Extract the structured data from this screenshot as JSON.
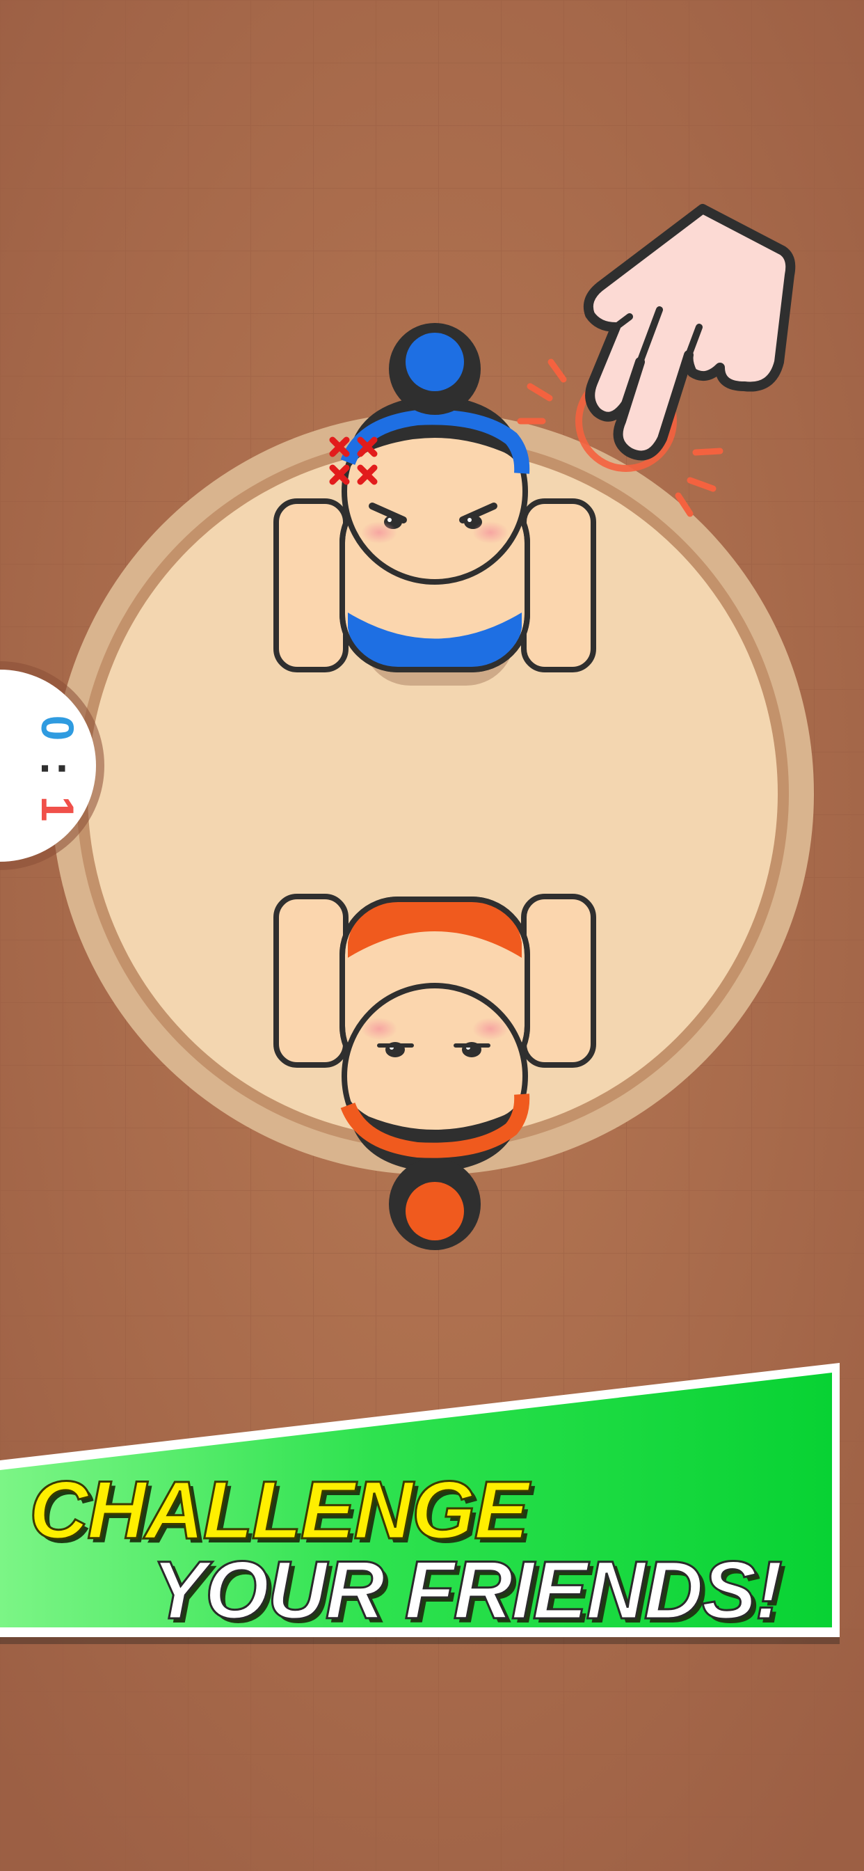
{
  "colors": {
    "floor": "#a5684a",
    "ring_outer": "#d9b48e",
    "ring_mid": "#c3926b",
    "ring_inner": "#f3d6b0",
    "skin": "#fbd6ae",
    "outline": "#2f2f2f",
    "hair": "#2f2f2f",
    "blue_team": "#1e6fe3",
    "orange_team": "#f05a1e",
    "score_blue": "#2f9be0",
    "score_red": "#f0504a",
    "banner_green": "#12d63c",
    "banner_yellow": "#ffef00",
    "banner_white": "#ffffff",
    "tap_effect": "#f4623f",
    "anger_mark": "#e21c1c"
  },
  "score": {
    "blue": "0",
    "separator": ":",
    "red": "1"
  },
  "players": {
    "top": {
      "team": "blue",
      "expression": "angry",
      "icon": "anger-vein-icon"
    },
    "bottom": {
      "team": "orange",
      "expression": "calm"
    }
  },
  "hint": {
    "icon": "pointing-hand-icon",
    "effect": "tap-ripple"
  },
  "banner": {
    "line1": "CHALLENGE",
    "line2": "YOUR FRIENDS!"
  }
}
